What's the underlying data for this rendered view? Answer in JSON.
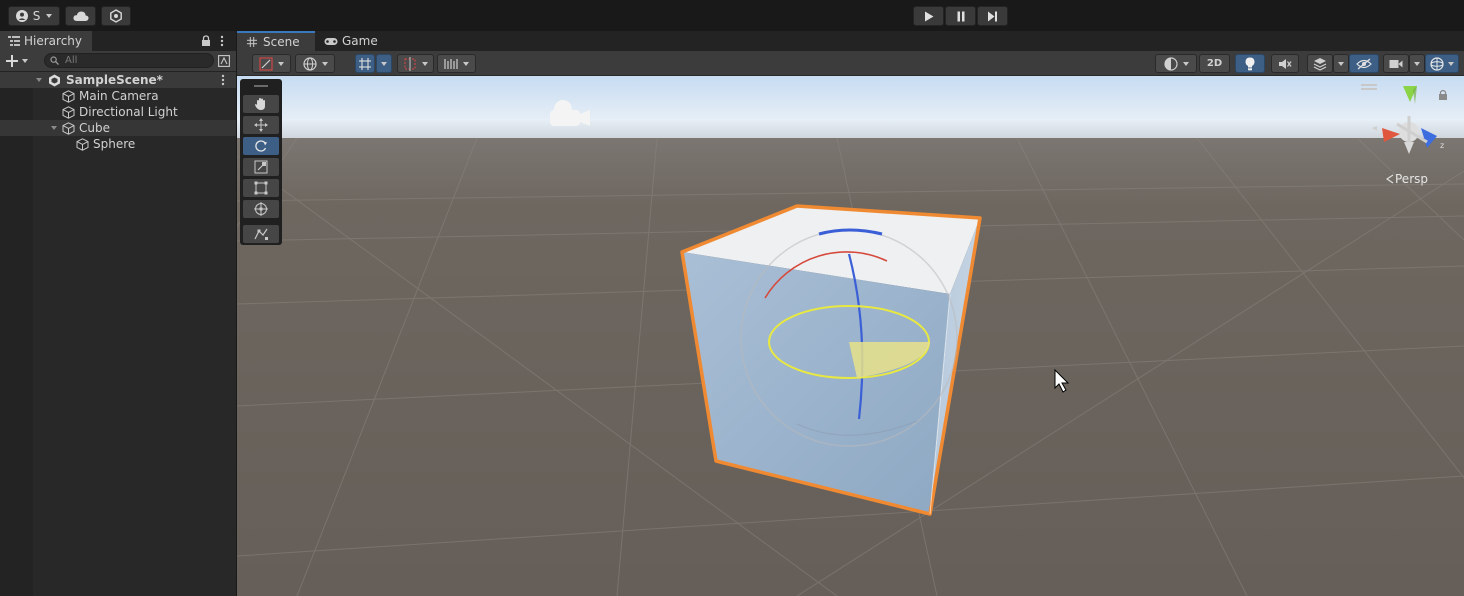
{
  "toolbar": {
    "account_label": "S",
    "play_icon": "play-icon",
    "pause_icon": "pause-icon",
    "step_icon": "step-icon"
  },
  "hierarchy": {
    "tab_label": "Hierarchy",
    "search_placeholder": "All",
    "items": [
      {
        "label": "SampleScene*",
        "icon": "unity-scene-icon"
      },
      {
        "label": "Main Camera",
        "icon": "cube-outline-icon"
      },
      {
        "label": "Directional Light",
        "icon": "cube-outline-icon"
      },
      {
        "label": "Cube",
        "icon": "cube-outline-icon"
      },
      {
        "label": "Sphere",
        "icon": "cube-outline-icon"
      }
    ]
  },
  "scene": {
    "tabs": [
      {
        "label": "Scene",
        "icon": "grid-icon"
      },
      {
        "label": "Game",
        "icon": "gamepad-icon"
      }
    ],
    "toolbar": {
      "mode_2d_label": "2D"
    },
    "persp_label": "Persp",
    "gizmo_axis_label": "z"
  },
  "colors": {
    "selection_outline": "#f08a32",
    "active_blue": "#3d5f86",
    "panel_bg": "#282828",
    "sky_top": "#c8dcf0",
    "ground": "#6d665f"
  }
}
